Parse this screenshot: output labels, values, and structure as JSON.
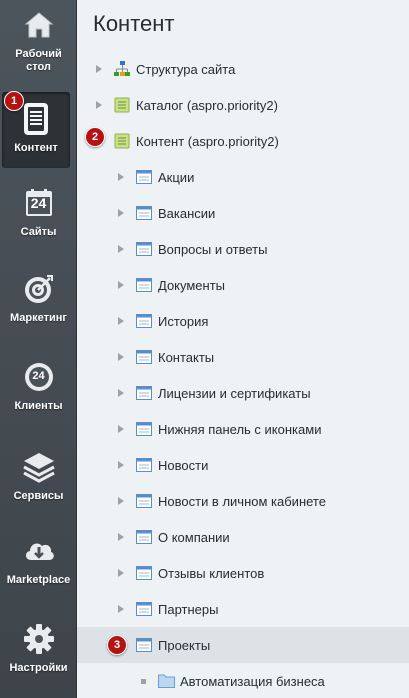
{
  "leftbar": {
    "items": [
      {
        "key": "desktop",
        "label": "Рабочий стол",
        "icon": "home-icon"
      },
      {
        "key": "content",
        "label": "Контент",
        "icon": "document-icon"
      },
      {
        "key": "sites",
        "label": "Сайты",
        "icon": "calendar-24-icon"
      },
      {
        "key": "marketing",
        "label": "Маркетинг",
        "icon": "target-icon"
      },
      {
        "key": "clients",
        "label": "Клиенты",
        "icon": "clients-24-icon"
      },
      {
        "key": "services",
        "label": "Сервисы",
        "icon": "layers-icon"
      },
      {
        "key": "marketplace",
        "label": "Marketplace",
        "icon": "cloud-download-icon"
      },
      {
        "key": "settings",
        "label": "Настройки",
        "icon": "gear-icon"
      }
    ],
    "desktop_label_line1": "Рабочий",
    "desktop_label_line2": "стол",
    "sites_number": "24",
    "clients_number": "24"
  },
  "badges": {
    "b1": "1",
    "b2": "2",
    "b3": "3"
  },
  "panel": {
    "title": "Контент",
    "tree": [
      {
        "label": "Структура сайта",
        "icon": "sitemap-icon",
        "level": 0,
        "expander": "arrow"
      },
      {
        "label": "Каталог (aspro.priority2)",
        "icon": "green-list-icon",
        "level": 0,
        "expander": "arrow"
      },
      {
        "label": "Контент (aspro.priority2)",
        "icon": "green-list-icon",
        "level": 0,
        "expander": "arrow-down"
      },
      {
        "label": "Акции",
        "icon": "window-icon",
        "level": 1,
        "expander": "arrow"
      },
      {
        "label": "Вакансии",
        "icon": "window-icon",
        "level": 1,
        "expander": "arrow"
      },
      {
        "label": "Вопросы и ответы",
        "icon": "window-icon",
        "level": 1,
        "expander": "arrow"
      },
      {
        "label": "Документы",
        "icon": "window-icon",
        "level": 1,
        "expander": "arrow"
      },
      {
        "label": "История",
        "icon": "window-icon",
        "level": 1,
        "expander": "arrow"
      },
      {
        "label": "Контакты",
        "icon": "window-icon",
        "level": 1,
        "expander": "arrow"
      },
      {
        "label": "Лицензии и сертификаты",
        "icon": "window-icon",
        "level": 1,
        "expander": "arrow"
      },
      {
        "label": "Нижняя панель с иконками",
        "icon": "window-icon",
        "level": 1,
        "expander": "arrow"
      },
      {
        "label": "Новости",
        "icon": "window-icon",
        "level": 1,
        "expander": "arrow"
      },
      {
        "label": "Новости в личном кабинете",
        "icon": "window-icon",
        "level": 1,
        "expander": "arrow"
      },
      {
        "label": "О компании",
        "icon": "window-icon",
        "level": 1,
        "expander": "arrow"
      },
      {
        "label": "Отзывы клиентов",
        "icon": "window-icon",
        "level": 1,
        "expander": "arrow"
      },
      {
        "label": "Партнеры",
        "icon": "window-icon",
        "level": 1,
        "expander": "arrow"
      },
      {
        "label": "Проекты",
        "icon": "window-icon",
        "level": 1,
        "expander": "none",
        "selected": true
      },
      {
        "label": "Автоматизация бизнеса",
        "icon": "folder-icon",
        "level": 2,
        "expander": "square"
      }
    ]
  },
  "colors": {
    "accent_badge": "#b51212",
    "leftbar": "#464e55",
    "panel_bg": "#eef2f4"
  }
}
